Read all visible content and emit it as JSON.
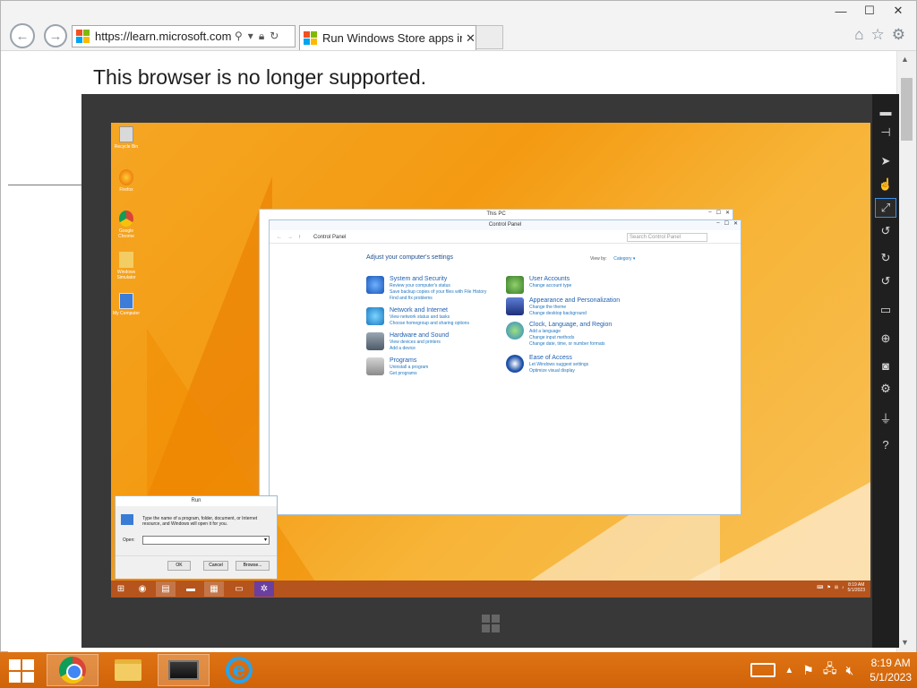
{
  "browser": {
    "address": "https://learn.microsoft.com/",
    "tab_title": "Run Windows Store apps in...",
    "minimize": "—",
    "maximize": "☐",
    "close": "✕",
    "tab_close": "✕"
  },
  "page": {
    "message": "This browser is no longer supported."
  },
  "guest": {
    "desktop_icons": [
      {
        "label": "Recycle Bin",
        "icon": "recycle-bin-icon"
      },
      {
        "label": "Firefox",
        "icon": "firefox-icon"
      },
      {
        "label": "Google Chrome",
        "icon": "chrome-icon"
      },
      {
        "label": "Windows Simulator",
        "icon": "simulator-icon"
      },
      {
        "label": "My Computer",
        "icon": "computer-icon"
      }
    ],
    "this_pc_title": "This PC",
    "control_panel": {
      "title": "Control Panel",
      "breadcrumb": "Control Panel",
      "search_placeholder": "Search Control Panel",
      "heading": "Adjust your computer's settings",
      "view_by_label": "View by:",
      "view_by_value": "Category ▾",
      "left_categories": [
        {
          "title": "System and Security",
          "links": [
            "Review your computer's status",
            "Save backup copies of your files with File History",
            "Find and fix problems"
          ]
        },
        {
          "title": "Network and Internet",
          "links": [
            "View network status and tasks",
            "Choose homegroup and sharing options"
          ]
        },
        {
          "title": "Hardware and Sound",
          "links": [
            "View devices and printers",
            "Add a device"
          ]
        },
        {
          "title": "Programs",
          "links": [
            "Uninstall a program",
            "Get programs"
          ]
        }
      ],
      "right_categories": [
        {
          "title": "User Accounts",
          "links": [
            "Change account type"
          ]
        },
        {
          "title": "Appearance and Personalization",
          "links": [
            "Change the theme",
            "Change desktop background"
          ]
        },
        {
          "title": "Clock, Language, and Region",
          "links": [
            "Add a language",
            "Change input methods",
            "Change date, time, or number formats"
          ]
        },
        {
          "title": "Ease of Access",
          "links": [
            "Let Windows suggest settings",
            "Optimize visual display"
          ]
        }
      ]
    },
    "run_dialog": {
      "title": "Run",
      "description": "Type the name of a program, folder, document, or Internet resource, and Windows will open it for you.",
      "open_label": "Open:",
      "ok": "OK",
      "cancel": "Cancel",
      "browse": "Browse..."
    },
    "clock_time": "8:19 AM",
    "clock_date": "5/1/2023"
  },
  "emulator_tools": [
    "minimize-icon",
    "pin-icon",
    "mouse-mode-icon",
    "touch-mode-icon",
    "pinch-zoom-icon",
    "rotation-touch-icon",
    "rotate-clockwise-icon",
    "rotate-counterclockwise-icon",
    "resolution-icon",
    "location-icon",
    "screenshot-icon",
    "settings-icon",
    "network-icon",
    "help-icon"
  ],
  "taskbar": {
    "time": "8:19 AM",
    "date": "5/1/2023"
  },
  "colors": {
    "taskbar": "#d86a0c",
    "desktop_accent": "#f5a623",
    "emulator_frame": "#383838",
    "link_blue": "#1f76c0"
  }
}
